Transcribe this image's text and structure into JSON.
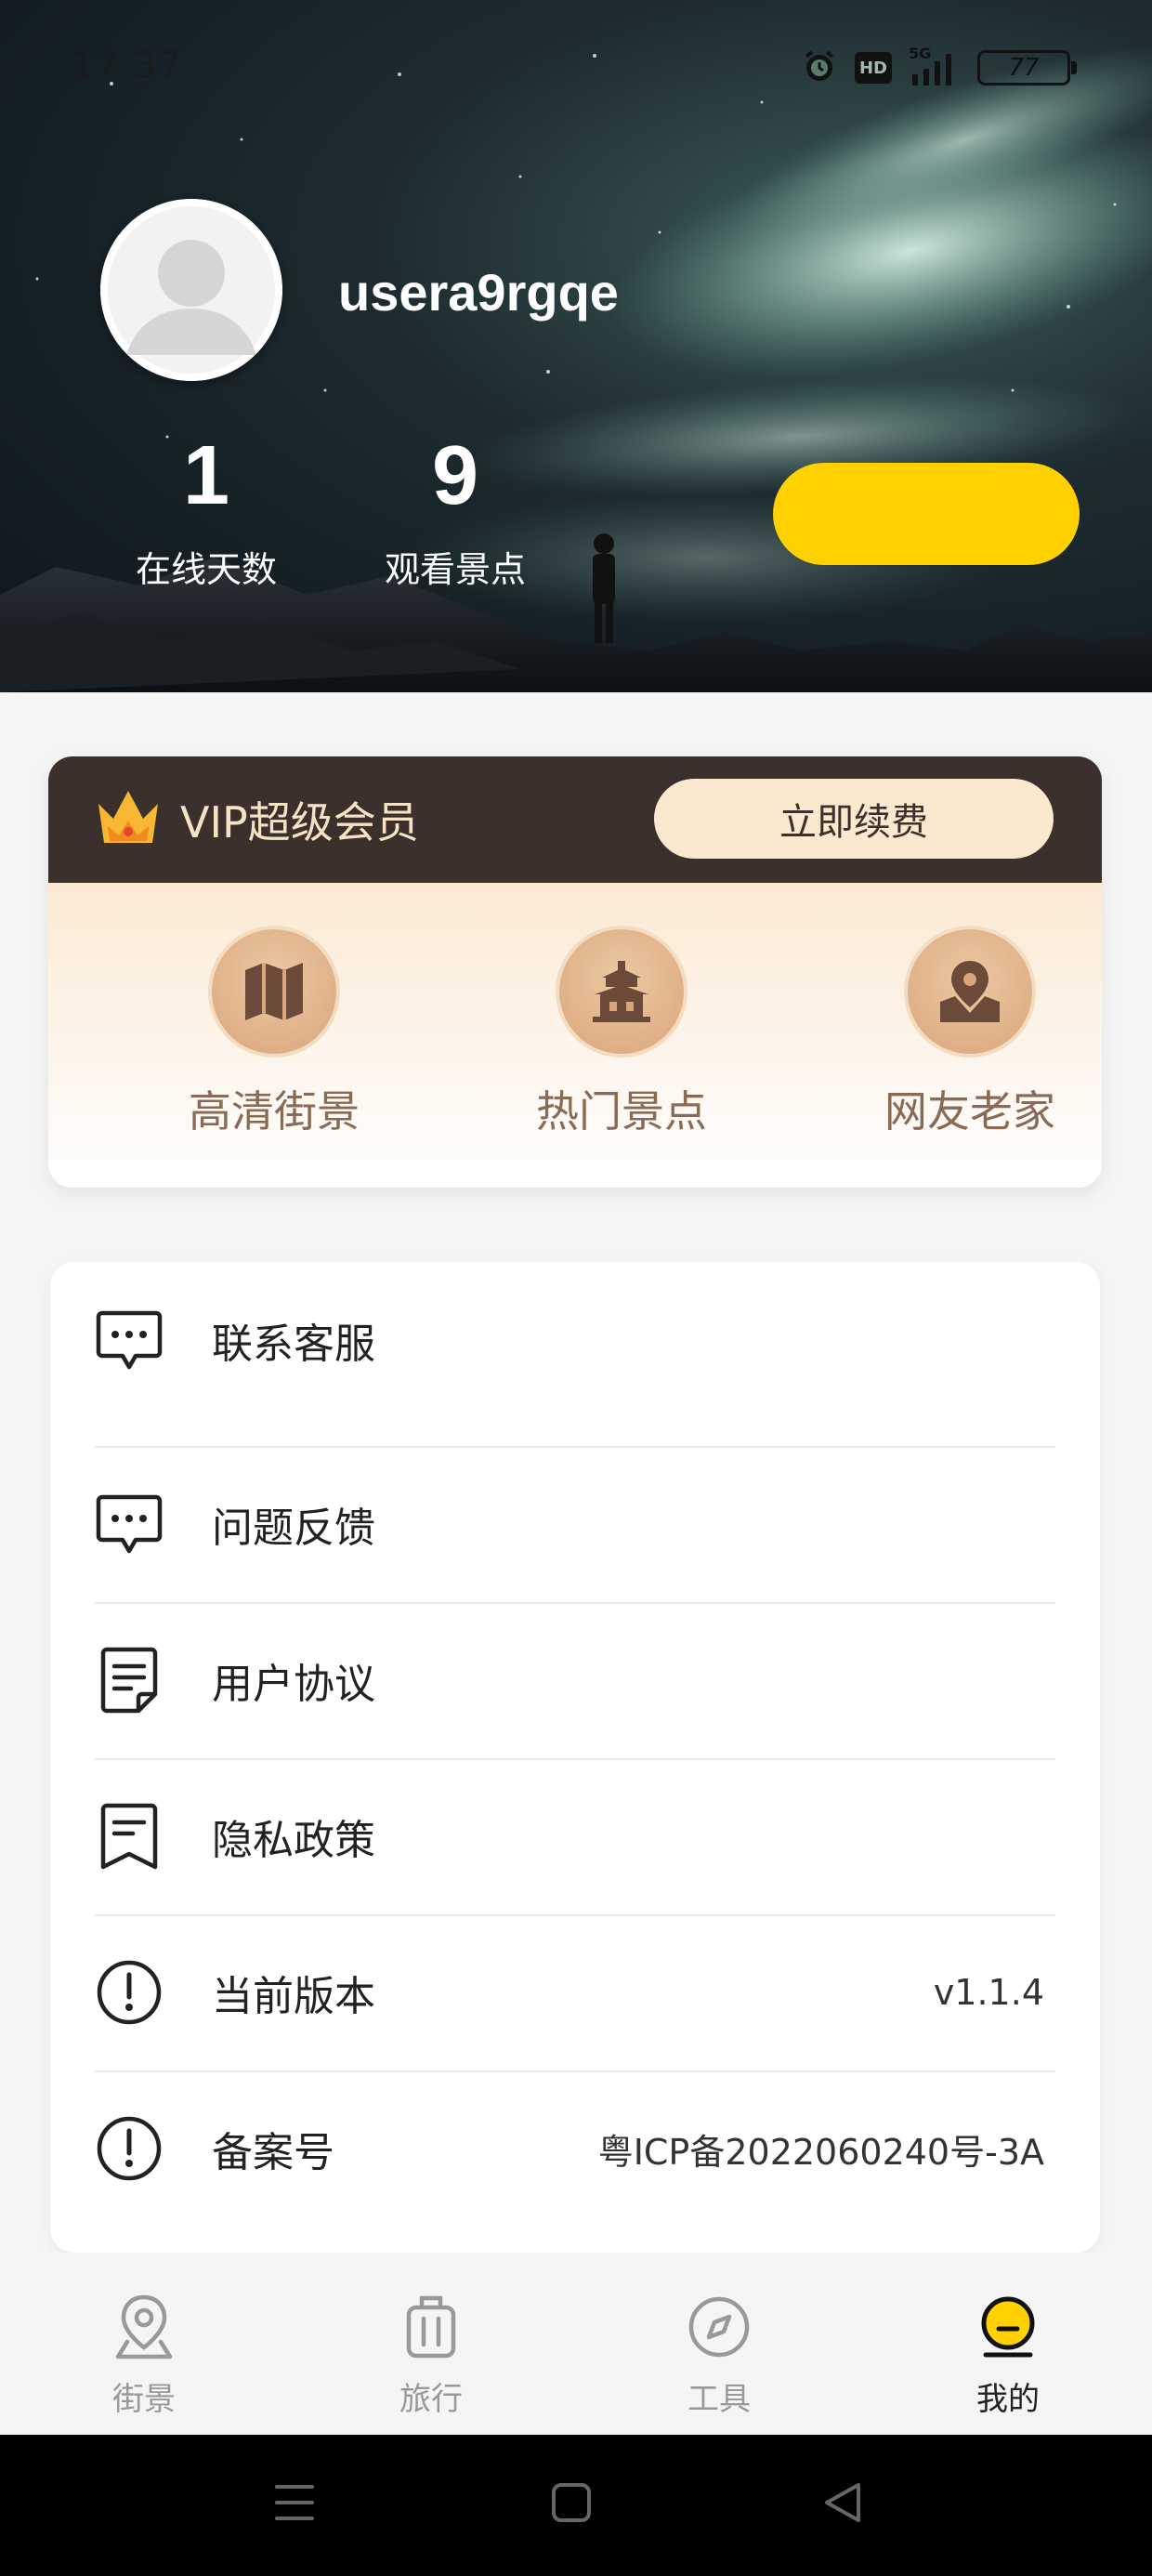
{
  "status_bar": {
    "time": "17:37",
    "network": "5G",
    "hd_badge": "HD",
    "battery": "77"
  },
  "profile": {
    "username": "usera9rgqe",
    "stats": [
      {
        "value": "1",
        "label": "在线天数"
      },
      {
        "value": "9",
        "label": "观看景点"
      }
    ]
  },
  "vip": {
    "title": "VIP超级会员",
    "renew_label": "立即续费",
    "features": [
      {
        "label": "高清街景",
        "icon": "map-icon"
      },
      {
        "label": "热门景点",
        "icon": "temple-icon"
      },
      {
        "label": "网友老家",
        "icon": "location-map-icon"
      }
    ]
  },
  "menu": {
    "items": [
      {
        "label": "联系客服",
        "icon": "chat-bubble-icon",
        "value": ""
      },
      {
        "label": "问题反馈",
        "icon": "feedback-bubble-icon",
        "value": ""
      },
      {
        "label": "用户协议",
        "icon": "document-icon",
        "value": ""
      },
      {
        "label": "隐私政策",
        "icon": "bookmark-icon",
        "value": ""
      },
      {
        "label": "当前版本",
        "icon": "info-icon",
        "value": "v1.1.4"
      },
      {
        "label": "备案号",
        "icon": "info-icon",
        "value": "粤ICP备2022060240号-3A"
      }
    ]
  },
  "tabs": [
    {
      "label": "街景",
      "icon": "location-pin-icon",
      "active": false
    },
    {
      "label": "旅行",
      "icon": "suitcase-icon",
      "active": false
    },
    {
      "label": "工具",
      "icon": "compass-icon",
      "active": false
    },
    {
      "label": "我的",
      "icon": "profile-icon",
      "active": true
    }
  ],
  "colors": {
    "accent_yellow": "#ffd100",
    "vip_dark": "#3b302b",
    "vip_gold": "#f6e3c6"
  }
}
